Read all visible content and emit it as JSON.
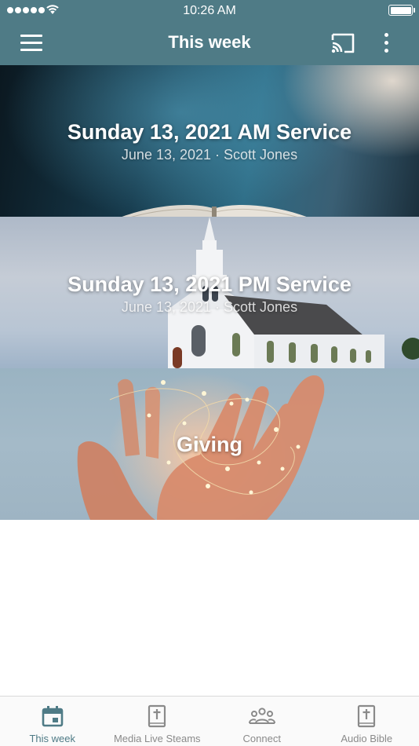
{
  "status_bar": {
    "time": "10:26 AM",
    "signal_icon": "signal-dots-icon",
    "wifi_icon": "wifi-icon",
    "battery_icon": "battery-icon"
  },
  "app_bar": {
    "title": "This week",
    "menu_icon": "hamburger-menu-icon",
    "cast_icon": "cast-icon",
    "more_icon": "more-vertical-icon",
    "background_color": "#4f7b86"
  },
  "cards": [
    {
      "title": "Sunday 13, 2021 AM Service",
      "subtitle": "June 13, 2021 · Scott Jones",
      "image": "open-bible-with-light-rays"
    },
    {
      "title": "Sunday 13, 2021 PM Service",
      "subtitle": "June 13, 2021 · Scott Jones",
      "image": "white-church-steeple"
    },
    {
      "title": "Giving",
      "subtitle": "",
      "image": "hands-holding-fairy-lights"
    }
  ],
  "tabs": [
    {
      "label": "This week",
      "icon": "calendar-icon",
      "active": true
    },
    {
      "label": "Media Live Steams",
      "icon": "bible-icon",
      "active": false
    },
    {
      "label": "Connect",
      "icon": "group-icon",
      "active": false
    },
    {
      "label": "Audio Bible",
      "icon": "bible-icon",
      "active": false
    }
  ],
  "colors": {
    "accent": "#4f7b86",
    "tab_inactive": "#8a8a8a"
  }
}
